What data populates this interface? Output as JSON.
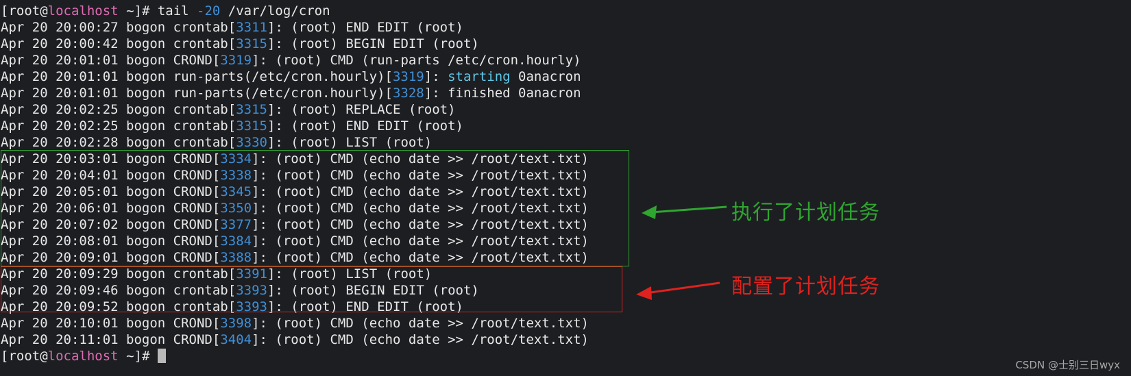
{
  "prompt": {
    "open": "[",
    "user_host_1": "root",
    "at": "@",
    "user_host_2": "localhost",
    "path": " ~]# "
  },
  "command": {
    "name": "tail ",
    "flag": "-20",
    "arg": " /var/log/cron"
  },
  "log_lines": [
    {
      "ts": "Apr 20 20:00:27 bogon ",
      "proc": "crontab",
      "pid": "3311",
      "msg": ": (root) END EDIT (root)"
    },
    {
      "ts": "Apr 20 20:00:42 bogon ",
      "proc": "crontab",
      "pid": "3315",
      "msg": ": (root) BEGIN EDIT (root)"
    },
    {
      "ts": "Apr 20 20:01:01 bogon ",
      "proc": "CROND",
      "pid": "3319",
      "msg": ": (root) CMD (run-parts /etc/cron.hourly)"
    },
    {
      "ts": "Apr 20 20:01:01 bogon ",
      "proc": "run-parts(/etc/cron.hourly)",
      "pid": "3319",
      "msg": ": ",
      "hl": "starting",
      "tail": " 0anacron"
    },
    {
      "ts": "Apr 20 20:01:01 bogon ",
      "proc": "run-parts(/etc/cron.hourly)",
      "pid": "3328",
      "msg": ": finished 0anacron"
    },
    {
      "ts": "Apr 20 20:02:25 bogon ",
      "proc": "crontab",
      "pid": "3315",
      "msg": ": (root) REPLACE (root)"
    },
    {
      "ts": "Apr 20 20:02:25 bogon ",
      "proc": "crontab",
      "pid": "3315",
      "msg": ": (root) END EDIT (root)"
    },
    {
      "ts": "Apr 20 20:02:28 bogon ",
      "proc": "crontab",
      "pid": "3330",
      "msg": ": (root) LIST (root)"
    },
    {
      "ts": "Apr 20 20:03:01 bogon ",
      "proc": "CROND",
      "pid": "3334",
      "msg": ": (root) CMD (echo date >> /root/text.txt)"
    },
    {
      "ts": "Apr 20 20:04:01 bogon ",
      "proc": "CROND",
      "pid": "3338",
      "msg": ": (root) CMD (echo date >> /root/text.txt)"
    },
    {
      "ts": "Apr 20 20:05:01 bogon ",
      "proc": "CROND",
      "pid": "3345",
      "msg": ": (root) CMD (echo date >> /root/text.txt)"
    },
    {
      "ts": "Apr 20 20:06:01 bogon ",
      "proc": "CROND",
      "pid": "3350",
      "msg": ": (root) CMD (echo date >> /root/text.txt)"
    },
    {
      "ts": "Apr 20 20:07:02 bogon ",
      "proc": "CROND",
      "pid": "3377",
      "msg": ": (root) CMD (echo date >> /root/text.txt)"
    },
    {
      "ts": "Apr 20 20:08:01 bogon ",
      "proc": "CROND",
      "pid": "3384",
      "msg": ": (root) CMD (echo date >> /root/text.txt)"
    },
    {
      "ts": "Apr 20 20:09:01 bogon ",
      "proc": "CROND",
      "pid": "3388",
      "msg": ": (root) CMD (echo date >> /root/text.txt)"
    },
    {
      "ts": "Apr 20 20:09:29 bogon ",
      "proc": "crontab",
      "pid": "3391",
      "msg": ": (root) LIST (root)"
    },
    {
      "ts": "Apr 20 20:09:46 bogon ",
      "proc": "crontab",
      "pid": "3393",
      "msg": ": (root) BEGIN EDIT (root)"
    },
    {
      "ts": "Apr 20 20:09:52 bogon ",
      "proc": "crontab",
      "pid": "3393",
      "msg": ": (root) END EDIT (root)"
    },
    {
      "ts": "Apr 20 20:10:01 bogon ",
      "proc": "CROND",
      "pid": "3398",
      "msg": ": (root) CMD (echo date >> /root/text.txt)"
    },
    {
      "ts": "Apr 20 20:11:01 bogon ",
      "proc": "CROND",
      "pid": "3404",
      "msg": ": (root) CMD (echo date >> /root/text.txt)"
    }
  ],
  "annotations": {
    "executed": "执行了计划任务",
    "configured": "配置了计划任务"
  },
  "colors": {
    "green": "#2fa630",
    "red": "#e0221e"
  },
  "watermark": "CSDN @士别三日wyx"
}
